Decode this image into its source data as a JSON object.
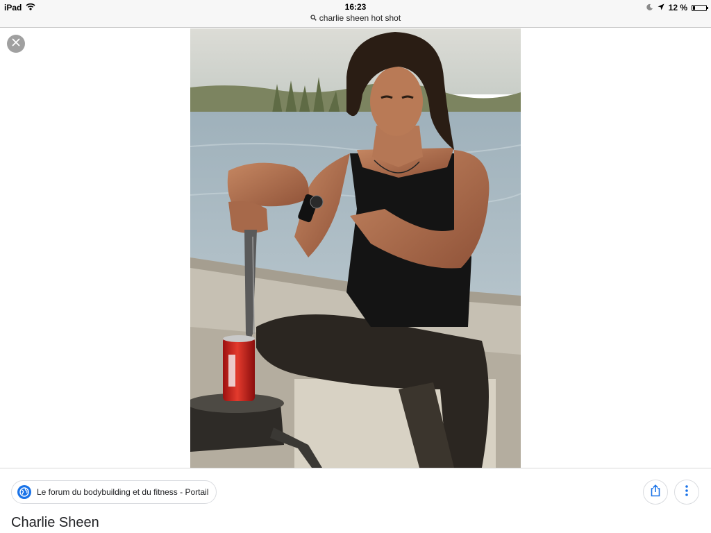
{
  "status_bar": {
    "device": "iPad",
    "time": "16:23",
    "battery_text": "12 %",
    "icons": [
      "wifi-icon",
      "moon-icon",
      "location-arrow-icon",
      "battery-icon"
    ]
  },
  "address_bar": {
    "search_query": "charlie sheen hot shot",
    "icon": "search-icon"
  },
  "viewer": {
    "close_icon": "close-icon",
    "image_subject": "Charlie Sheen"
  },
  "panel": {
    "source_label": "Le forum du bodybuilding et du fitness - Portail",
    "source_icon": "globe-icon",
    "share_icon": "share-icon",
    "more_icon": "more-vertical-icon",
    "title": "Charlie Sheen"
  },
  "colors": {
    "accent": "#1a73e8",
    "close_button_bg": "#a0a0a0",
    "topbar_bg": "#f7f7f7"
  }
}
